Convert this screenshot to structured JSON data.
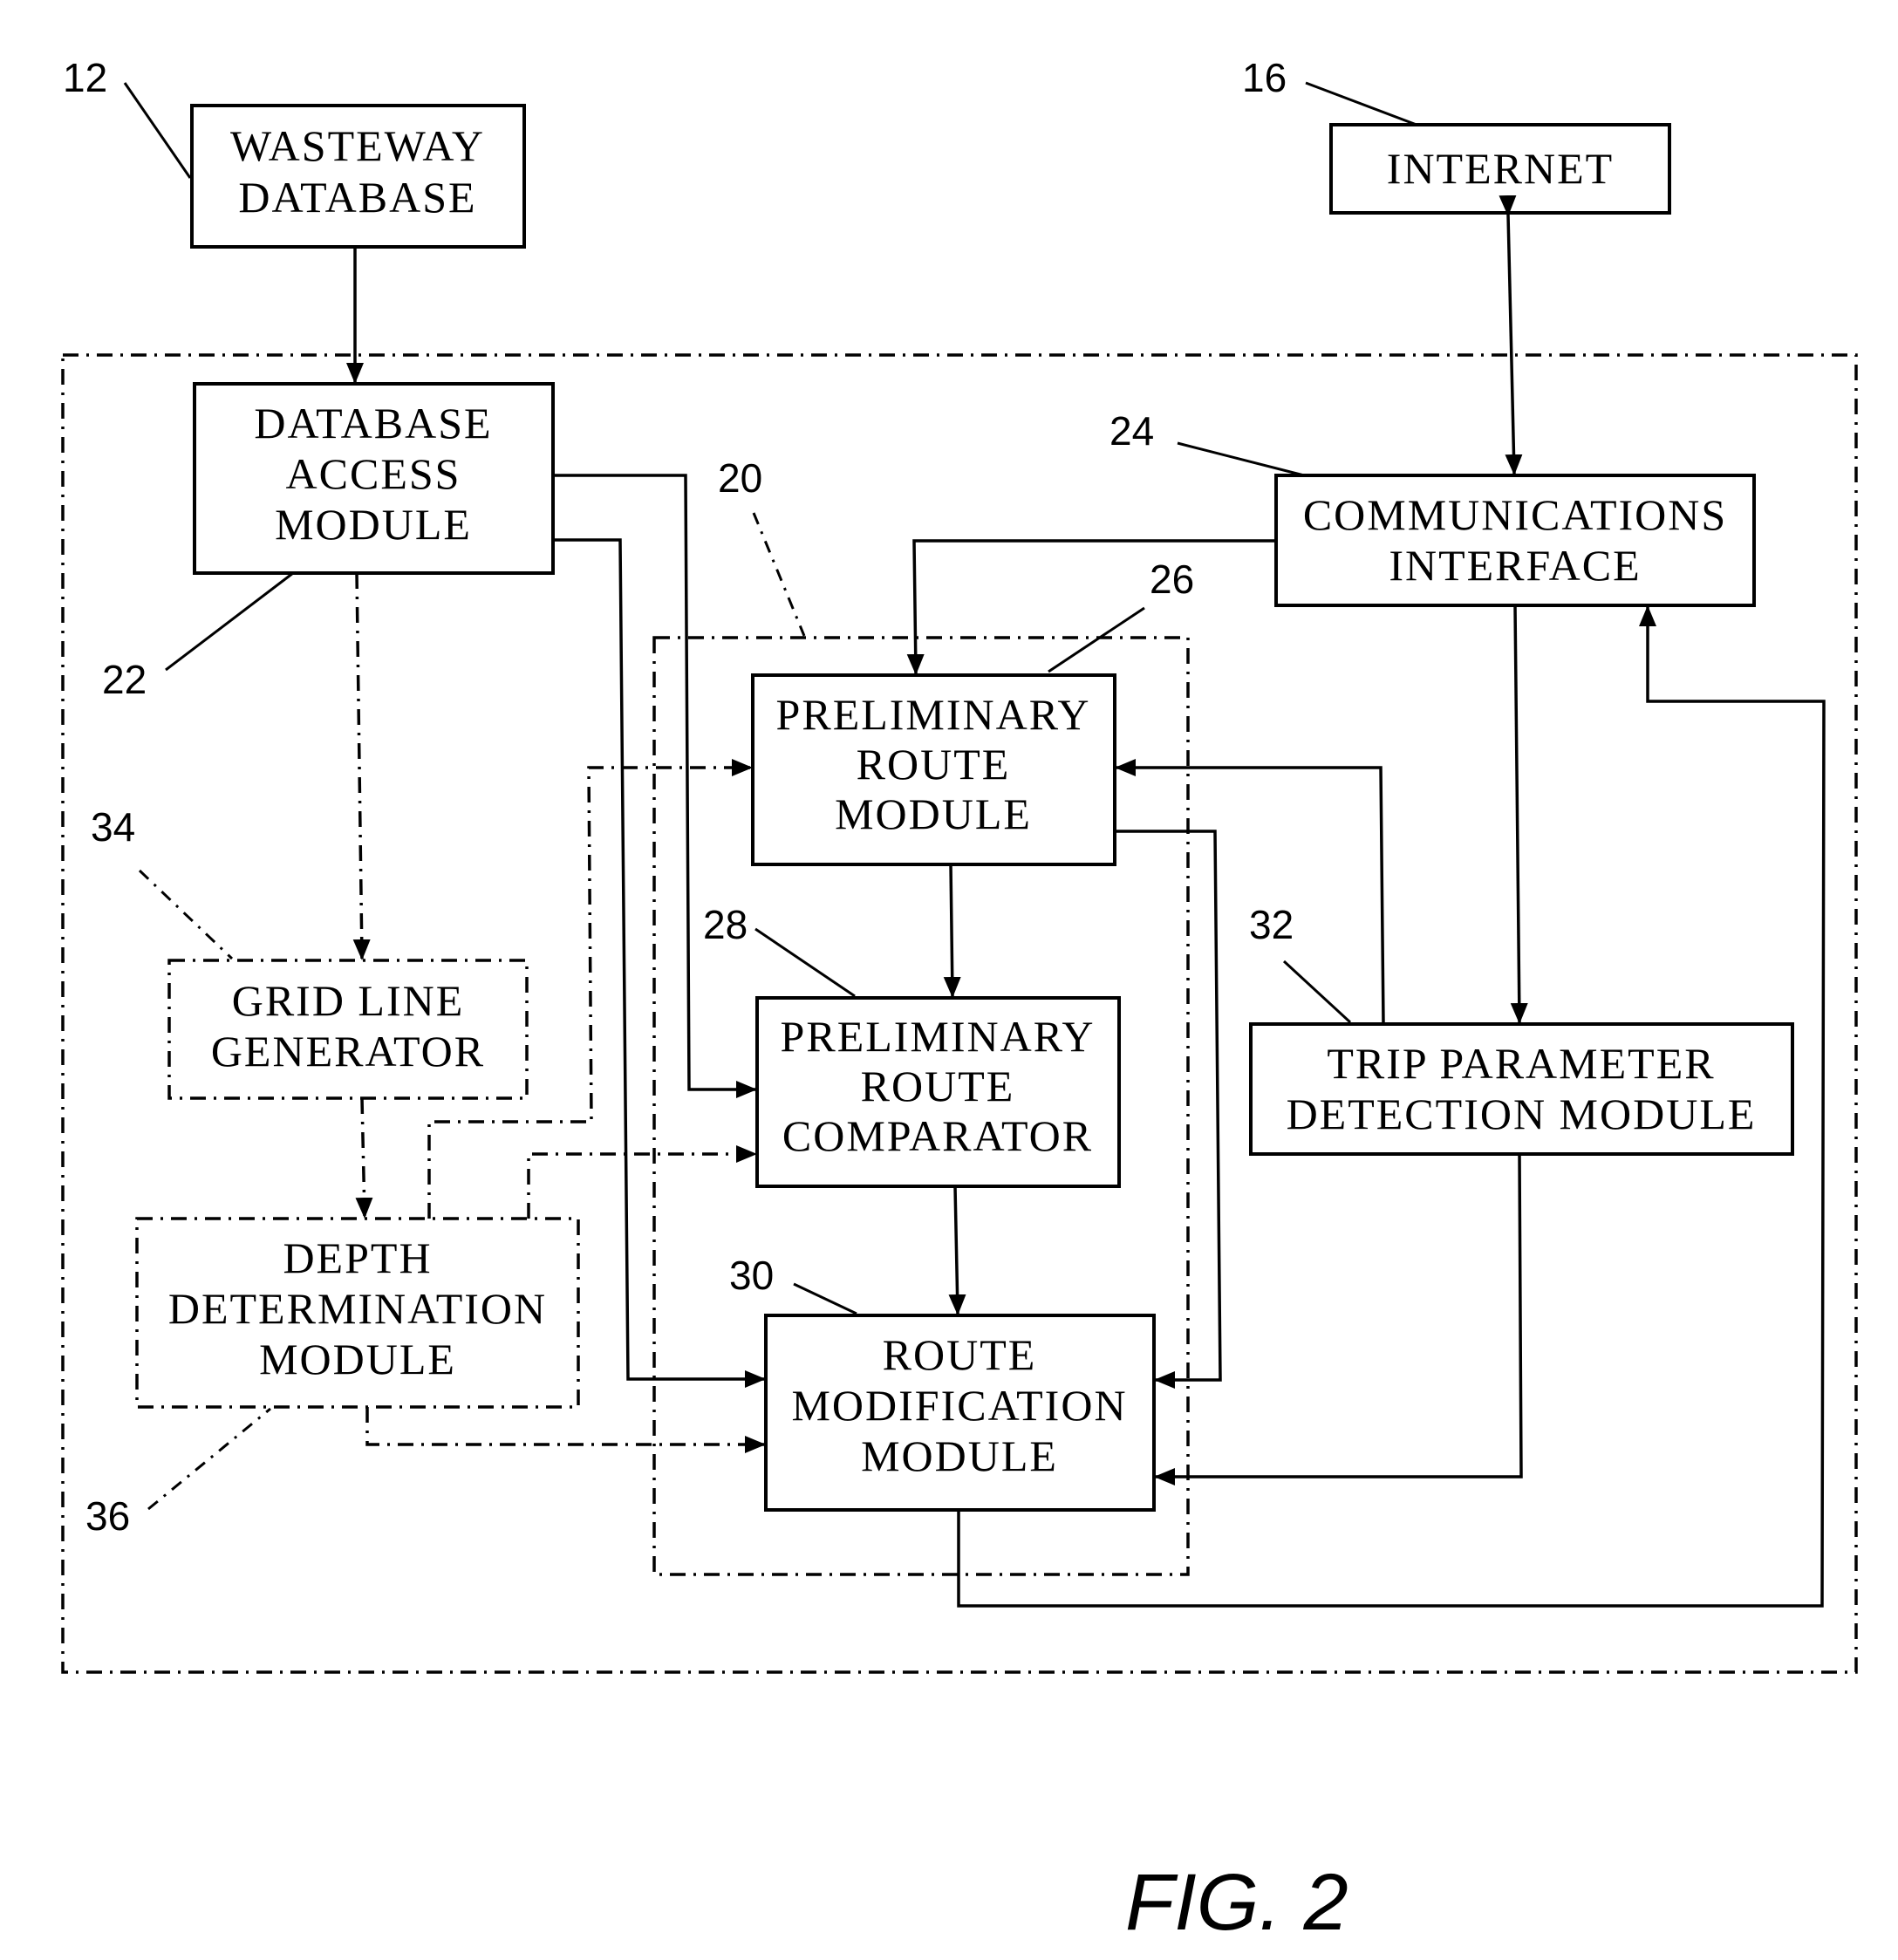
{
  "figure": {
    "caption": "FIG. 2"
  },
  "blocks": {
    "wasteway_database": {
      "ref": "12",
      "lines": [
        "WASTEWAY",
        "DATABASE"
      ]
    },
    "internet": {
      "ref": "16",
      "lines": [
        "INTERNET"
      ]
    },
    "system": {
      "ref": "20"
    },
    "database_access_module": {
      "ref": "22",
      "lines": [
        "DATABASE",
        "ACCESS",
        "MODULE"
      ]
    },
    "communications_interface": {
      "ref": "24",
      "lines": [
        "COMMUNICATIONS",
        "INTERFACE"
      ]
    },
    "preliminary_route_module": {
      "ref": "26",
      "lines": [
        "PRELIMINARY",
        "ROUTE",
        "MODULE"
      ]
    },
    "preliminary_route_comparator": {
      "ref": "28",
      "lines": [
        "PRELIMINARY",
        "ROUTE",
        "COMPARATOR"
      ]
    },
    "route_modification_module": {
      "ref": "30",
      "lines": [
        "ROUTE",
        "MODIFICATION",
        "MODULE"
      ]
    },
    "trip_parameter_detection_module": {
      "ref": "32",
      "lines": [
        "TRIP PARAMETER",
        "DETECTION MODULE"
      ]
    },
    "grid_line_generator": {
      "ref": "34",
      "lines": [
        "GRID LINE",
        "GENERATOR"
      ]
    },
    "depth_determination_module": {
      "ref": "36",
      "lines": [
        "DEPTH",
        "DETERMINATION",
        "MODULE"
      ]
    }
  },
  "connections": [
    {
      "from": "wasteway_database",
      "to": "database_access_module",
      "style": "solid"
    },
    {
      "from": "internet",
      "to": "communications_interface",
      "style": "solid",
      "bidirectional": true
    },
    {
      "from": "database_access_module",
      "to": "preliminary_route_comparator",
      "style": "solid"
    },
    {
      "from": "database_access_module",
      "to": "route_modification_module",
      "style": "solid"
    },
    {
      "from": "database_access_module",
      "to": "grid_line_generator",
      "style": "dash-dot"
    },
    {
      "from": "communications_interface",
      "to": "preliminary_route_module",
      "style": "solid"
    },
    {
      "from": "communications_interface",
      "to": "trip_parameter_detection_module",
      "style": "solid"
    },
    {
      "from": "trip_parameter_detection_module",
      "to": "preliminary_route_module",
      "style": "solid"
    },
    {
      "from": "trip_parameter_detection_module",
      "to": "route_modification_module",
      "style": "solid"
    },
    {
      "from": "preliminary_route_module",
      "to": "preliminary_route_comparator",
      "style": "solid"
    },
    {
      "from": "preliminary_route_module",
      "to": "route_modification_module",
      "style": "solid"
    },
    {
      "from": "preliminary_route_comparator",
      "to": "route_modification_module",
      "style": "solid"
    },
    {
      "from": "route_modification_module",
      "to": "communications_interface",
      "style": "solid"
    },
    {
      "from": "grid_line_generator",
      "to": "depth_determination_module",
      "style": "dash-dot"
    },
    {
      "from": "depth_determination_module",
      "to": "preliminary_route_module",
      "style": "dash-dot"
    },
    {
      "from": "depth_determination_module",
      "to": "preliminary_route_comparator",
      "style": "dash-dot"
    },
    {
      "from": "depth_determination_module",
      "to": "route_modification_module",
      "style": "dash-dot"
    }
  ]
}
